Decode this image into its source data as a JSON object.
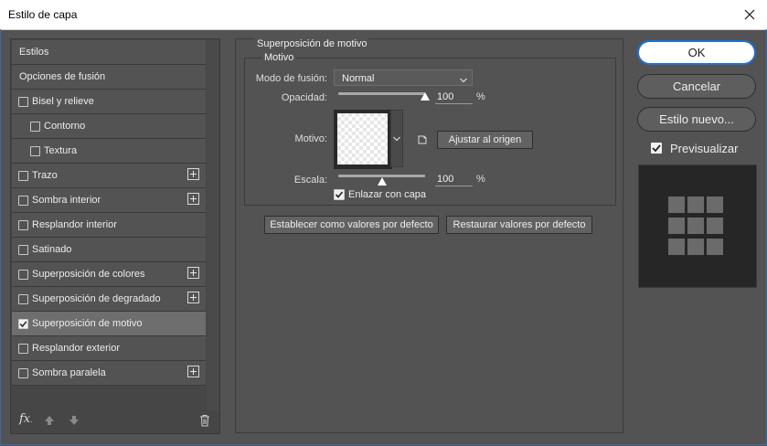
{
  "window": {
    "title": "Estilo de capa"
  },
  "styles_list": [
    {
      "label": "Estilos",
      "checkbox": false,
      "indent": 0,
      "plus": false,
      "selected": false
    },
    {
      "label": "Opciones de fusión",
      "checkbox": false,
      "indent": 0,
      "plus": false,
      "selected": false
    },
    {
      "label": "Bisel y relieve",
      "checkbox": true,
      "checked": false,
      "indent": 0,
      "plus": false,
      "selected": false
    },
    {
      "label": "Contorno",
      "checkbox": true,
      "checked": false,
      "indent": 1,
      "plus": false,
      "selected": false
    },
    {
      "label": "Textura",
      "checkbox": true,
      "checked": false,
      "indent": 1,
      "plus": false,
      "selected": false
    },
    {
      "label": "Trazo",
      "checkbox": true,
      "checked": false,
      "indent": 0,
      "plus": true,
      "selected": false
    },
    {
      "label": "Sombra interior",
      "checkbox": true,
      "checked": false,
      "indent": 0,
      "plus": true,
      "selected": false
    },
    {
      "label": "Resplandor interior",
      "checkbox": true,
      "checked": false,
      "indent": 0,
      "plus": false,
      "selected": false
    },
    {
      "label": "Satinado",
      "checkbox": true,
      "checked": false,
      "indent": 0,
      "plus": false,
      "selected": false
    },
    {
      "label": "Superposición de colores",
      "checkbox": true,
      "checked": false,
      "indent": 0,
      "plus": true,
      "selected": false
    },
    {
      "label": "Superposición de degradado",
      "checkbox": true,
      "checked": false,
      "indent": 0,
      "plus": true,
      "selected": false
    },
    {
      "label": "Superposición de motivo",
      "checkbox": true,
      "checked": true,
      "indent": 0,
      "plus": false,
      "selected": true
    },
    {
      "label": "Resplandor exterior",
      "checkbox": true,
      "checked": false,
      "indent": 0,
      "plus": false,
      "selected": false
    },
    {
      "label": "Sombra paralela",
      "checkbox": true,
      "checked": false,
      "indent": 0,
      "plus": true,
      "selected": false
    }
  ],
  "left_toolbar": {
    "fx_label": "fx",
    "fx_suffix": "."
  },
  "section": {
    "title": "Superposición de motivo",
    "group_title": "Motivo",
    "blend_mode_label": "Modo de fusión:",
    "blend_mode_value": "Normal",
    "opacity_label": "Opacidad:",
    "opacity_value": "100",
    "opacity_unit": "%",
    "opacity_level": 100,
    "pattern_label": "Motivo:",
    "snap_origin_button": "Ajustar al origen",
    "scale_label": "Escala:",
    "scale_value": "100",
    "scale_unit": "%",
    "scale_level_percent": 50,
    "link_layer_label": "Enlazar con capa",
    "link_layer_checked": true,
    "set_default_button": "Establecer como valores por defecto",
    "reset_default_button": "Restaurar valores por defecto"
  },
  "right": {
    "ok_button": "OK",
    "cancel_button": "Cancelar",
    "new_style_button": "Estilo nuevo...",
    "preview_label": "Previsualizar",
    "preview_checked": true
  },
  "colors": {
    "accent": "#1f6fd6",
    "panel": "#535353",
    "selected_row": "#6e6e6e"
  }
}
